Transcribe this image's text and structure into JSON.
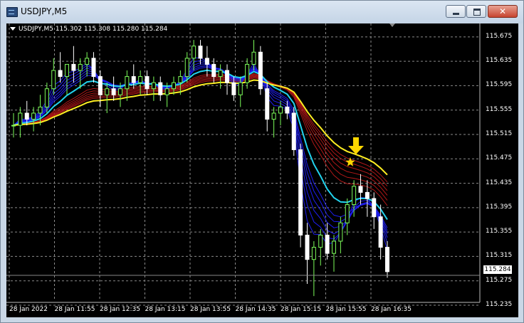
{
  "window": {
    "title": "USDJPY,M5"
  },
  "chart": {
    "symbol_info": "USDJPY,M5  115.302 115.308 115.280 115.284",
    "current_price": "115.284",
    "price_ticks": [
      "115.675",
      "115.635",
      "115.595",
      "115.555",
      "115.515",
      "115.475",
      "115.435",
      "115.395",
      "115.355",
      "115.315",
      "115.275",
      "115.235"
    ],
    "time_ticks": [
      "28 Jan 2022",
      "28 Jan 11:55",
      "28 Jan 12:35",
      "28 Jan 13:15",
      "28 Jan 13:55",
      "28 Jan 14:35",
      "28 Jan 15:15",
      "28 Jan 15:55",
      "28 Jan 16:35"
    ],
    "colors": {
      "background": "#000000",
      "grid": "#8a8a8a",
      "bull_candle": "#7cfc5a",
      "bear_candle": "#ffffff",
      "fast_ma": "#1e1ef0",
      "slow_ma": "#b01818",
      "cyan_ma": "#22d3ee",
      "yellow_ma": "#ffee22",
      "signal_arrow": "#ffd700"
    },
    "markers": {
      "signal_arrow_icon": "down-arrow-icon",
      "signal_star_icon": "star-icon"
    }
  },
  "chart_data": {
    "type": "candlestick",
    "ylim": [
      115.235,
      115.69
    ],
    "candles_ohlc": [
      [
        115.53,
        115.55,
        115.51,
        115.53
      ],
      [
        115.53,
        115.56,
        115.51,
        115.55
      ],
      [
        115.55,
        115.57,
        115.53,
        115.54
      ],
      [
        115.54,
        115.56,
        115.52,
        115.55
      ],
      [
        115.55,
        115.58,
        115.53,
        115.56
      ],
      [
        115.56,
        115.6,
        115.55,
        115.59
      ],
      [
        115.59,
        115.64,
        115.58,
        115.62
      ],
      [
        115.62,
        115.65,
        115.6,
        115.61
      ],
      [
        115.61,
        115.63,
        115.58,
        115.63
      ],
      [
        115.63,
        115.66,
        115.6,
        115.62
      ],
      [
        115.62,
        115.64,
        115.59,
        115.63
      ],
      [
        115.63,
        115.65,
        115.61,
        115.64
      ],
      [
        115.64,
        115.65,
        115.6,
        115.61
      ],
      [
        115.61,
        115.62,
        115.56,
        115.58
      ],
      [
        115.58,
        115.6,
        115.55,
        115.59
      ],
      [
        115.59,
        115.61,
        115.57,
        115.58
      ],
      [
        115.58,
        115.6,
        115.56,
        115.59
      ],
      [
        115.59,
        115.62,
        115.57,
        115.61
      ],
      [
        115.61,
        115.63,
        115.59,
        115.6
      ],
      [
        115.6,
        115.62,
        115.58,
        115.61
      ],
      [
        115.61,
        115.62,
        115.58,
        115.59
      ],
      [
        115.59,
        115.61,
        115.57,
        115.6
      ],
      [
        115.6,
        115.61,
        115.57,
        115.58
      ],
      [
        115.58,
        115.6,
        115.56,
        115.59
      ],
      [
        115.59,
        115.61,
        115.58,
        115.6
      ],
      [
        115.6,
        115.62,
        115.58,
        115.61
      ],
      [
        115.61,
        115.65,
        115.6,
        115.64
      ],
      [
        115.64,
        115.67,
        115.62,
        115.66
      ],
      [
        115.66,
        115.67,
        115.63,
        115.64
      ],
      [
        115.64,
        115.66,
        115.61,
        115.63
      ],
      [
        115.63,
        115.64,
        115.6,
        115.61
      ],
      [
        115.61,
        115.63,
        115.59,
        115.62
      ],
      [
        115.62,
        115.63,
        115.58,
        115.6
      ],
      [
        115.6,
        115.61,
        115.57,
        115.58
      ],
      [
        115.58,
        115.61,
        115.56,
        115.6
      ],
      [
        115.6,
        115.64,
        115.59,
        115.63
      ],
      [
        115.63,
        115.67,
        115.62,
        115.65
      ],
      [
        115.65,
        115.66,
        115.58,
        115.59
      ],
      [
        115.59,
        115.6,
        115.52,
        115.54
      ],
      [
        115.54,
        115.56,
        115.51,
        115.55
      ],
      [
        115.55,
        115.57,
        115.53,
        115.56
      ],
      [
        115.56,
        115.57,
        115.54,
        115.55
      ],
      [
        115.55,
        115.56,
        115.48,
        115.49
      ],
      [
        115.49,
        115.5,
        115.33,
        115.35
      ],
      [
        115.35,
        115.37,
        115.27,
        115.31
      ],
      [
        115.31,
        115.34,
        115.25,
        115.33
      ],
      [
        115.33,
        115.36,
        115.3,
        115.35
      ],
      [
        115.35,
        115.37,
        115.31,
        115.32
      ],
      [
        115.32,
        115.35,
        115.29,
        115.34
      ],
      [
        115.34,
        115.38,
        115.32,
        115.37
      ],
      [
        115.37,
        115.41,
        115.35,
        115.4
      ],
      [
        115.4,
        115.44,
        115.38,
        115.43
      ],
      [
        115.43,
        115.45,
        115.4,
        115.42
      ],
      [
        115.42,
        115.44,
        115.38,
        115.41
      ],
      [
        115.41,
        115.42,
        115.36,
        115.38
      ],
      [
        115.38,
        115.4,
        115.31,
        115.33
      ],
      [
        115.33,
        115.34,
        115.28,
        115.29
      ]
    ]
  }
}
